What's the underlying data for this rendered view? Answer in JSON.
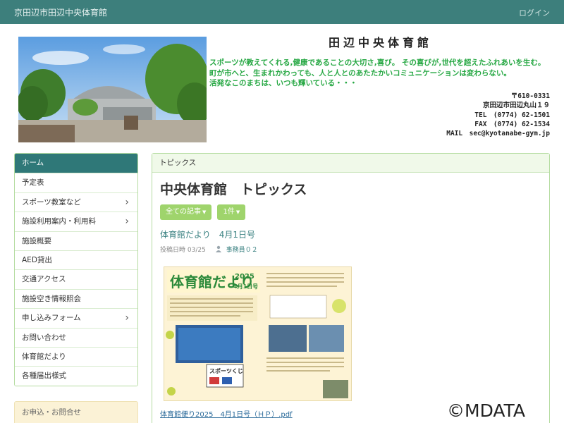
{
  "topbar": {
    "site_title": "京田辺市田辺中央体育館",
    "login": "ログイン"
  },
  "header": {
    "hall_title": "田辺中央体育館",
    "slogan": [
      "スポーツが教えてくれる,健康であることの大切さ,喜び。 その喜びが,世代を超えたふれあいを生む。",
      "町が市へと、生まれかわっても、人と人とのあたたかいコミュニケーションは変わらない。",
      "活発なこのまちは、いつも輝いている・・・"
    ],
    "contact": {
      "postal": "〒610-0331",
      "address": "京田辺市田辺丸山１９",
      "tel": "TEL　(0774) 62-1501",
      "fax": "FAX　(0774) 62-1534",
      "mail": "MAIL　sec@kyotanabe-gym.jp"
    }
  },
  "sidebar": {
    "items": [
      {
        "label": "ホーム",
        "active": true,
        "submenu": false
      },
      {
        "label": "予定表",
        "active": false,
        "submenu": false
      },
      {
        "label": "スポーツ教室など",
        "active": false,
        "submenu": true
      },
      {
        "label": "施設利用案内・利用料",
        "active": false,
        "submenu": true
      },
      {
        "label": "施設概要",
        "active": false,
        "submenu": false
      },
      {
        "label": "AED貸出",
        "active": false,
        "submenu": false
      },
      {
        "label": "交通アクセス",
        "active": false,
        "submenu": false
      },
      {
        "label": "施設空き情報照会",
        "active": false,
        "submenu": false
      },
      {
        "label": "申し込みフォーム",
        "active": false,
        "submenu": true
      },
      {
        "label": "お問い合わせ",
        "active": false,
        "submenu": false
      },
      {
        "label": "体育館だより",
        "active": false,
        "submenu": false
      },
      {
        "label": "各種届出様式",
        "active": false,
        "submenu": false
      }
    ],
    "inquiry_label": "お申込・お問合せ"
  },
  "main": {
    "panel_header": "トピックス",
    "page_title": "中央体育館　トピックス",
    "filters": {
      "all_posts": "全ての記事",
      "count": "1件"
    },
    "post": {
      "title": "体育館だより　4月1日号",
      "date_label": "投稿日時",
      "date": "03/25",
      "author": "事務員０２",
      "flyer": {
        "heading": "体育館だより",
        "year": "2025",
        "issue": "4月1日号",
        "sponsor": "スポーツくじ"
      },
      "pdf_link": "体育館便り2025　4月1日号（ＨＰ）.pdf"
    }
  },
  "watermark": "©MDATA",
  "colors": {
    "topbar": "#3d7f7c",
    "accent_green": "#9fd46c",
    "slogan_green": "#27a844",
    "link_teal": "#3a8181"
  },
  "icons": {
    "submenu": "chevron-right-icon",
    "author": "person-icon"
  }
}
